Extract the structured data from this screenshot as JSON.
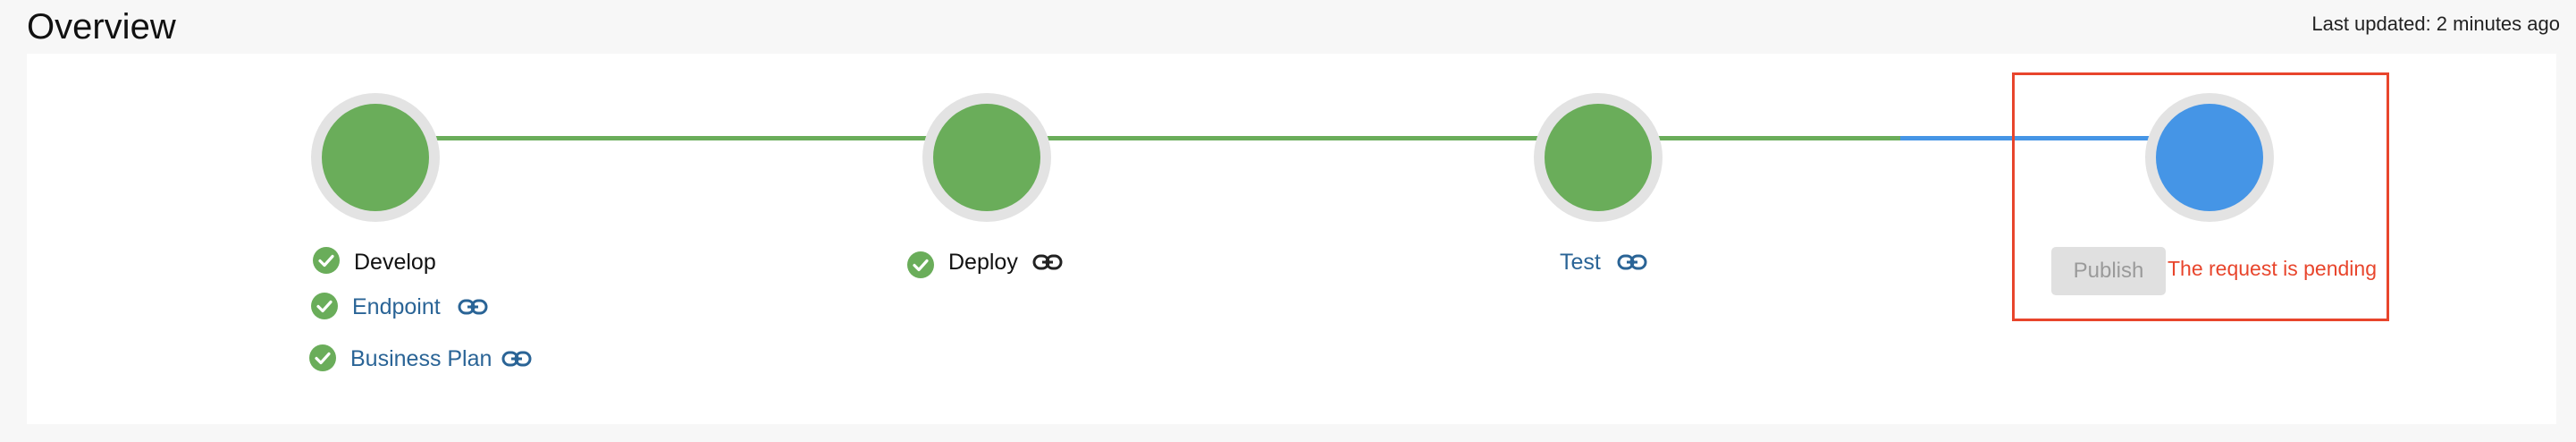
{
  "header": {
    "title": "Overview",
    "last_updated": "Last updated: 2 minutes ago"
  },
  "colors": {
    "complete": "#6aad5a",
    "active": "#4595e6",
    "link": "#2a6496",
    "error": "#e8452c",
    "ring": "#e3e3e3"
  },
  "stages": [
    {
      "name": "develop",
      "status": "complete",
      "items": [
        {
          "label": "Develop",
          "type": "text",
          "checked": true
        },
        {
          "label": "Endpoint",
          "type": "link",
          "checked": true,
          "has_link_icon": true
        },
        {
          "label": "Business Plan",
          "type": "link",
          "checked": true,
          "has_link_icon": true
        }
      ]
    },
    {
      "name": "deploy",
      "status": "complete",
      "items": [
        {
          "label": "Deploy",
          "type": "text",
          "checked": true,
          "has_link_icon": true
        }
      ]
    },
    {
      "name": "test",
      "status": "complete",
      "items": [
        {
          "label": "Test",
          "type": "link",
          "checked": false,
          "has_link_icon": true
        }
      ]
    },
    {
      "name": "publish",
      "status": "active",
      "button_label": "Publish",
      "button_disabled": true,
      "message": "The request is pending"
    }
  ]
}
